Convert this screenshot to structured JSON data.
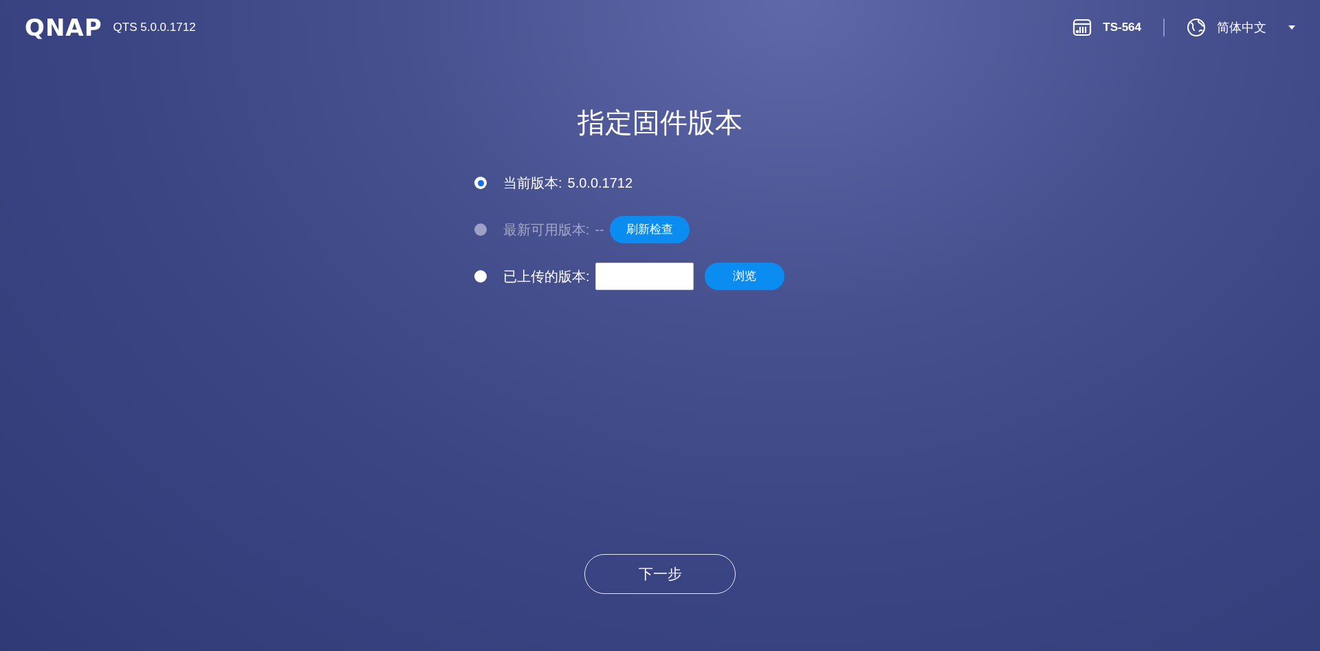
{
  "header": {
    "logo": "QNAP",
    "version": "QTS 5.0.0.1712",
    "device": "TS-564",
    "language": "简体中文"
  },
  "title": "指定固件版本",
  "options": [
    {
      "label": "当前版本:",
      "value": "5.0.0.1712",
      "selected": true,
      "disabled": false
    },
    {
      "label": "最新可用版本:",
      "value": "--",
      "selected": false,
      "disabled": true,
      "button": "刷新检查"
    },
    {
      "label": "已上传的版本:",
      "selected": false,
      "disabled": false,
      "field": true,
      "button": "浏览"
    }
  ],
  "next_button": "下一步"
}
